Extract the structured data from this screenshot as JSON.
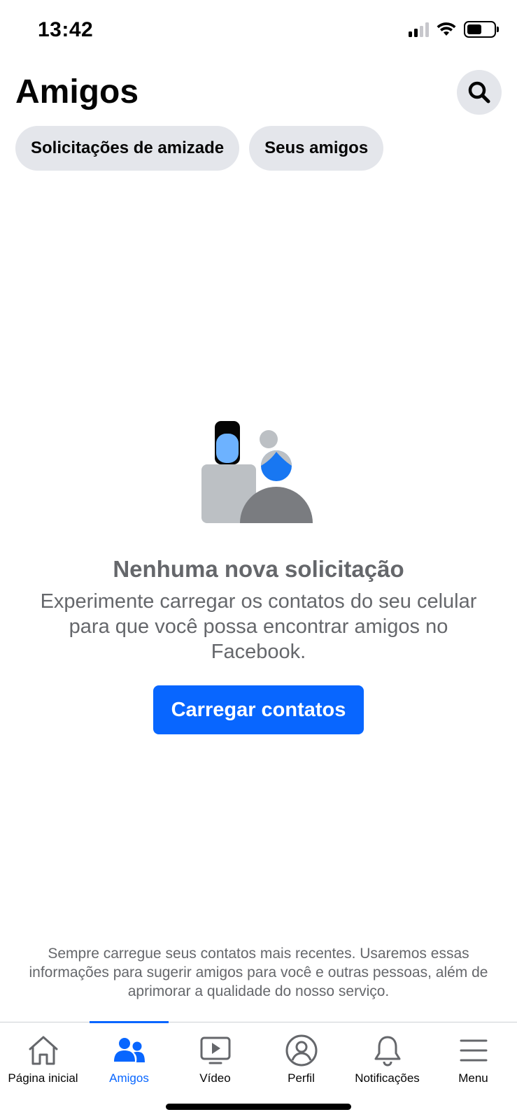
{
  "status_bar": {
    "time": "13:42"
  },
  "header": {
    "title": "Amigos",
    "search_icon": "search-icon"
  },
  "chips": [
    {
      "label": "Solicitações de amizade"
    },
    {
      "label": "Seus amigos"
    }
  ],
  "empty_state": {
    "title": "Nenhuma nova solicitação",
    "description": "Experimente carregar os contatos do seu celular para que você possa encontrar amigos no Facebook.",
    "button_label": "Carregar contatos"
  },
  "footer_note": "Sempre carregue seus contatos mais recentes. Usaremos essas informações para sugerir amigos para você e outras pessoas, além de aprimorar a qualidade do nosso serviço.",
  "tab_bar": {
    "active": "Amigos",
    "tabs": [
      {
        "label": "Página inicial",
        "icon": "home-icon"
      },
      {
        "label": "Amigos",
        "icon": "friends-icon"
      },
      {
        "label": "Vídeo",
        "icon": "video-icon"
      },
      {
        "label": "Perfil",
        "icon": "profile-icon"
      },
      {
        "label": "Notificações",
        "icon": "bell-icon"
      },
      {
        "label": "Menu",
        "icon": "menu-icon"
      }
    ]
  },
  "colors": {
    "accent": "#0866ff",
    "chip_bg": "#e4e6eb",
    "secondary_text": "#65676b"
  }
}
